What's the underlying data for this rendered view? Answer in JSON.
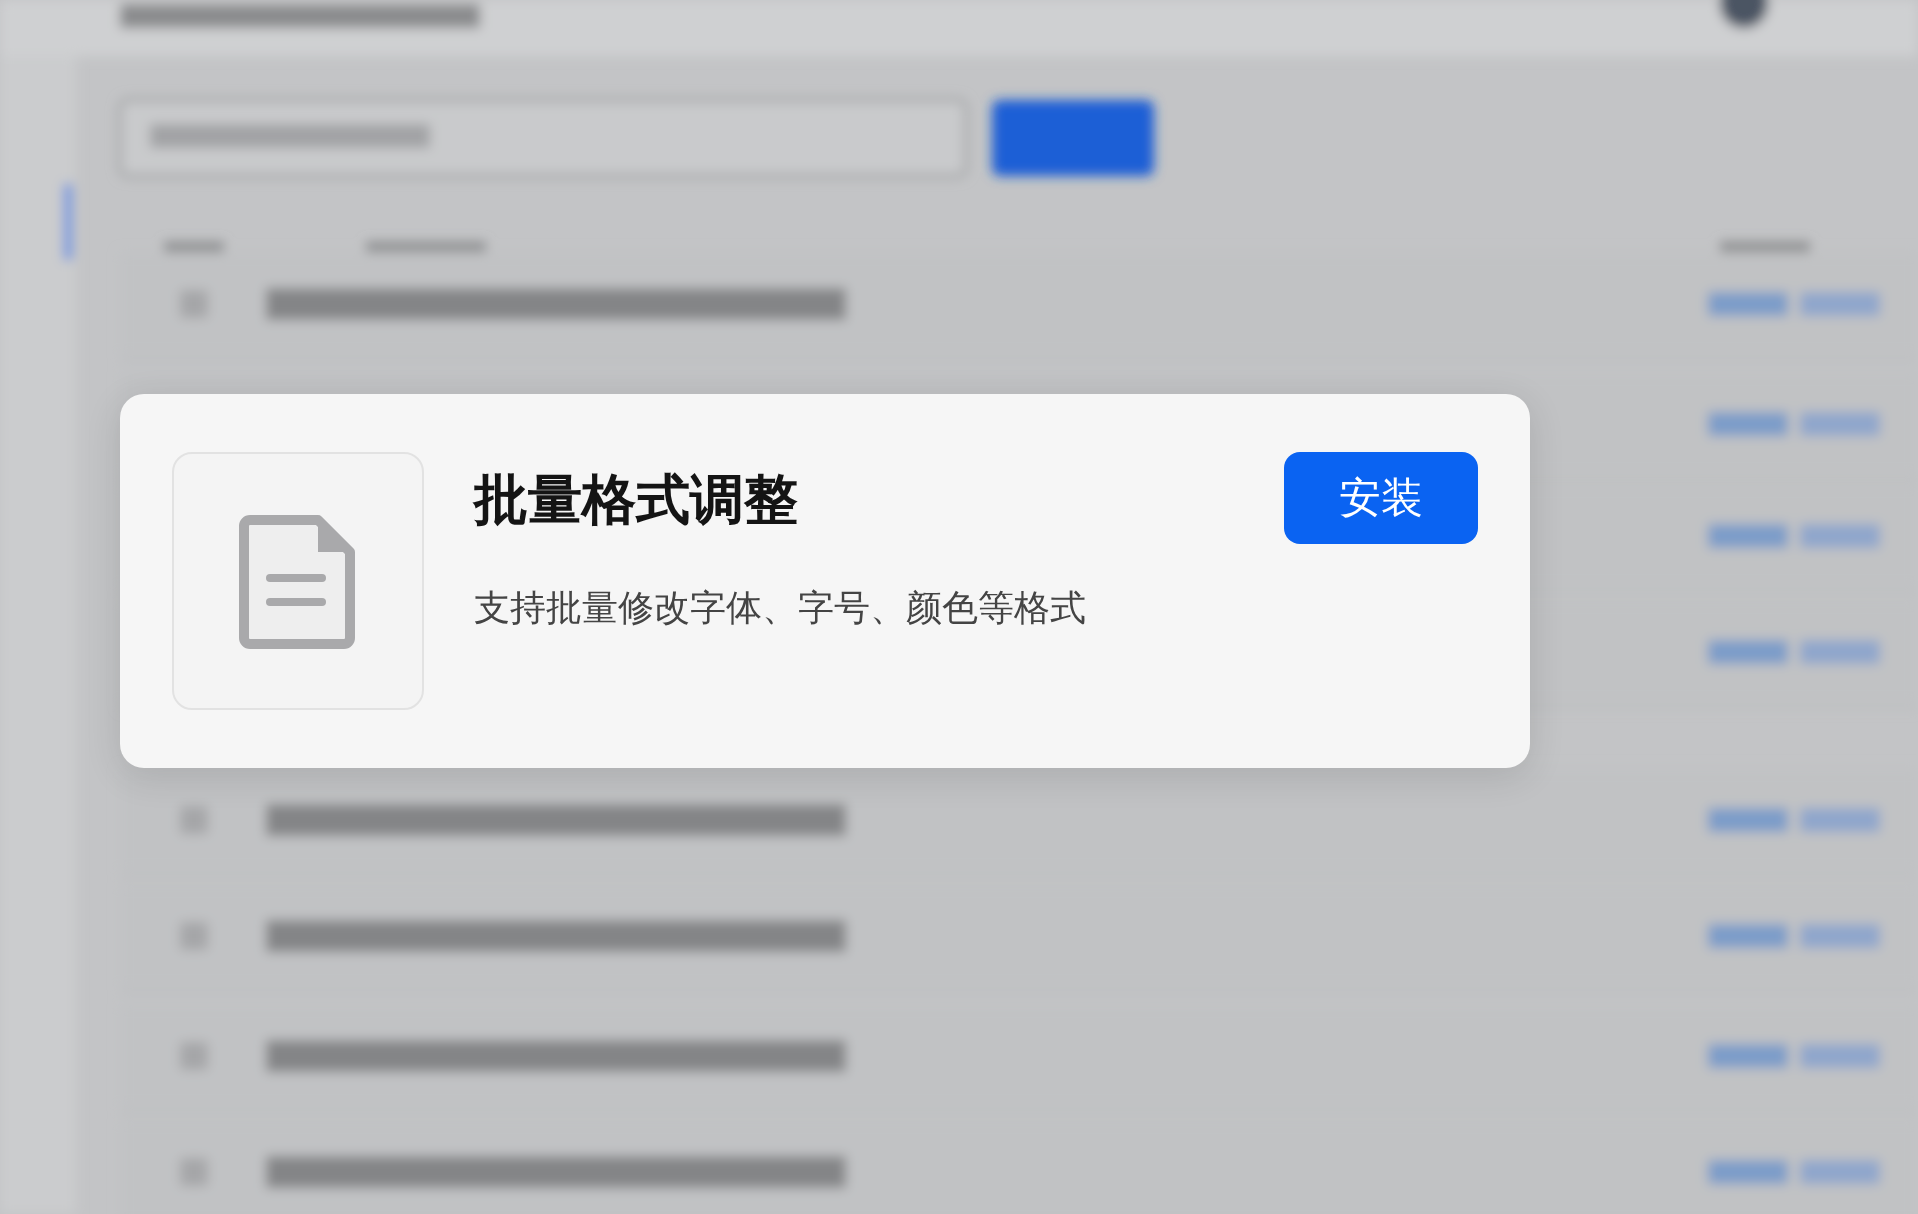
{
  "plugin_card": {
    "title": "批量格式调整",
    "description": "支持批量修改字体、字号、颜色等格式",
    "install_button": "安装"
  }
}
